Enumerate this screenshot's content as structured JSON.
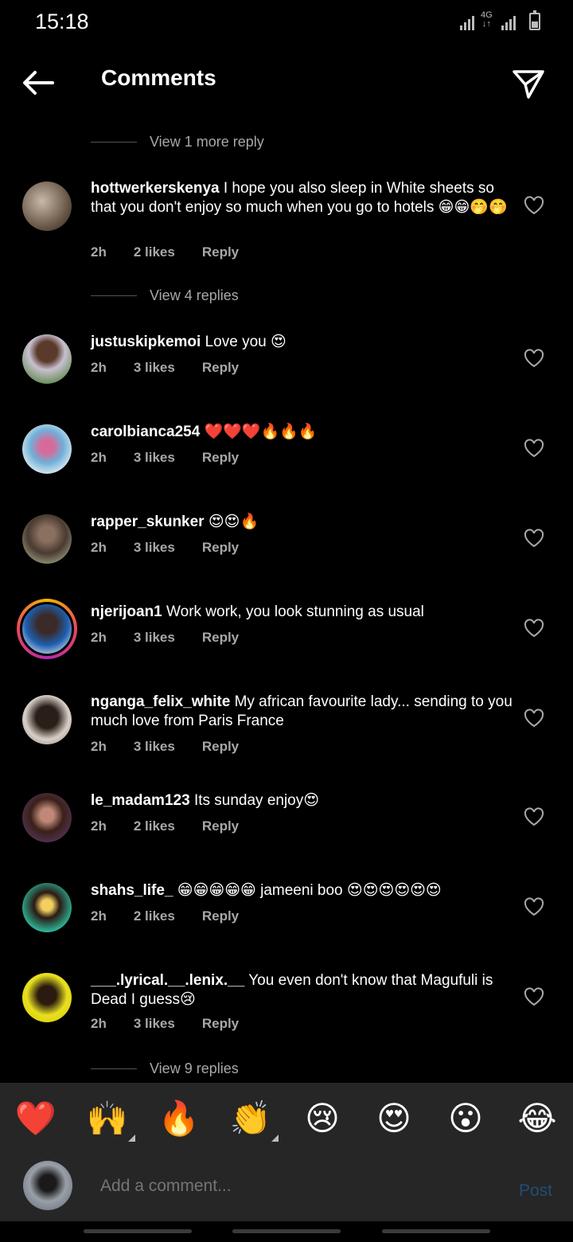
{
  "status": {
    "time": "15:18",
    "network": "4G"
  },
  "header": {
    "title": "Comments"
  },
  "view_more_top": "View 1 more reply",
  "comments": [
    {
      "user": "hottwerkerskenya",
      "text": "I hope you also sleep in White sheets so that you don't enjoy so much when you go to hotels 😁😁🤭🤭",
      "time": "2h",
      "likes": "2 likes",
      "reply": "Reply"
    },
    {
      "user": "justuskipkemoi",
      "text": "Love you 😍",
      "time": "2h",
      "likes": "3 likes",
      "reply": "Reply"
    },
    {
      "user": "carolbianca254",
      "text": "❤️❤️❤️🔥🔥🔥",
      "time": "2h",
      "likes": "3 likes",
      "reply": "Reply"
    },
    {
      "user": "rapper_skunker",
      "text": "😍😍🔥",
      "time": "2h",
      "likes": "3 likes",
      "reply": "Reply"
    },
    {
      "user": "njerijoan1",
      "text": "Work work, you look stunning as usual",
      "time": "2h",
      "likes": "3 likes",
      "reply": "Reply"
    },
    {
      "user": "nganga_felix_white",
      "text": "My african favourite lady... sending to you much love from Paris France",
      "time": "2h",
      "likes": "3 likes",
      "reply": "Reply"
    },
    {
      "user": "le_madam123",
      "text": "Its sunday enjoy😍",
      "time": "2h",
      "likes": "2 likes",
      "reply": "Reply"
    },
    {
      "user": "shahs_life_",
      "text": "😁😁😁😁😁 jameeni boo 😍😍😍😍😍😍",
      "time": "2h",
      "likes": "2 likes",
      "reply": "Reply"
    },
    {
      "user": "___.lyrical.__.lenix.__",
      "text": "You even don't know that Magufuli is Dead I guess😢",
      "time": "2h",
      "likes": "3 likes",
      "reply": "Reply"
    }
  ],
  "view_replies_1": "View 4 replies",
  "view_replies_2": "View 9 replies",
  "quick_emojis": [
    "❤️",
    "🙌",
    "🔥",
    "👏",
    "😢",
    "😍",
    "😮",
    "😂"
  ],
  "input": {
    "placeholder": "Add a comment...",
    "post_label": "Post"
  }
}
